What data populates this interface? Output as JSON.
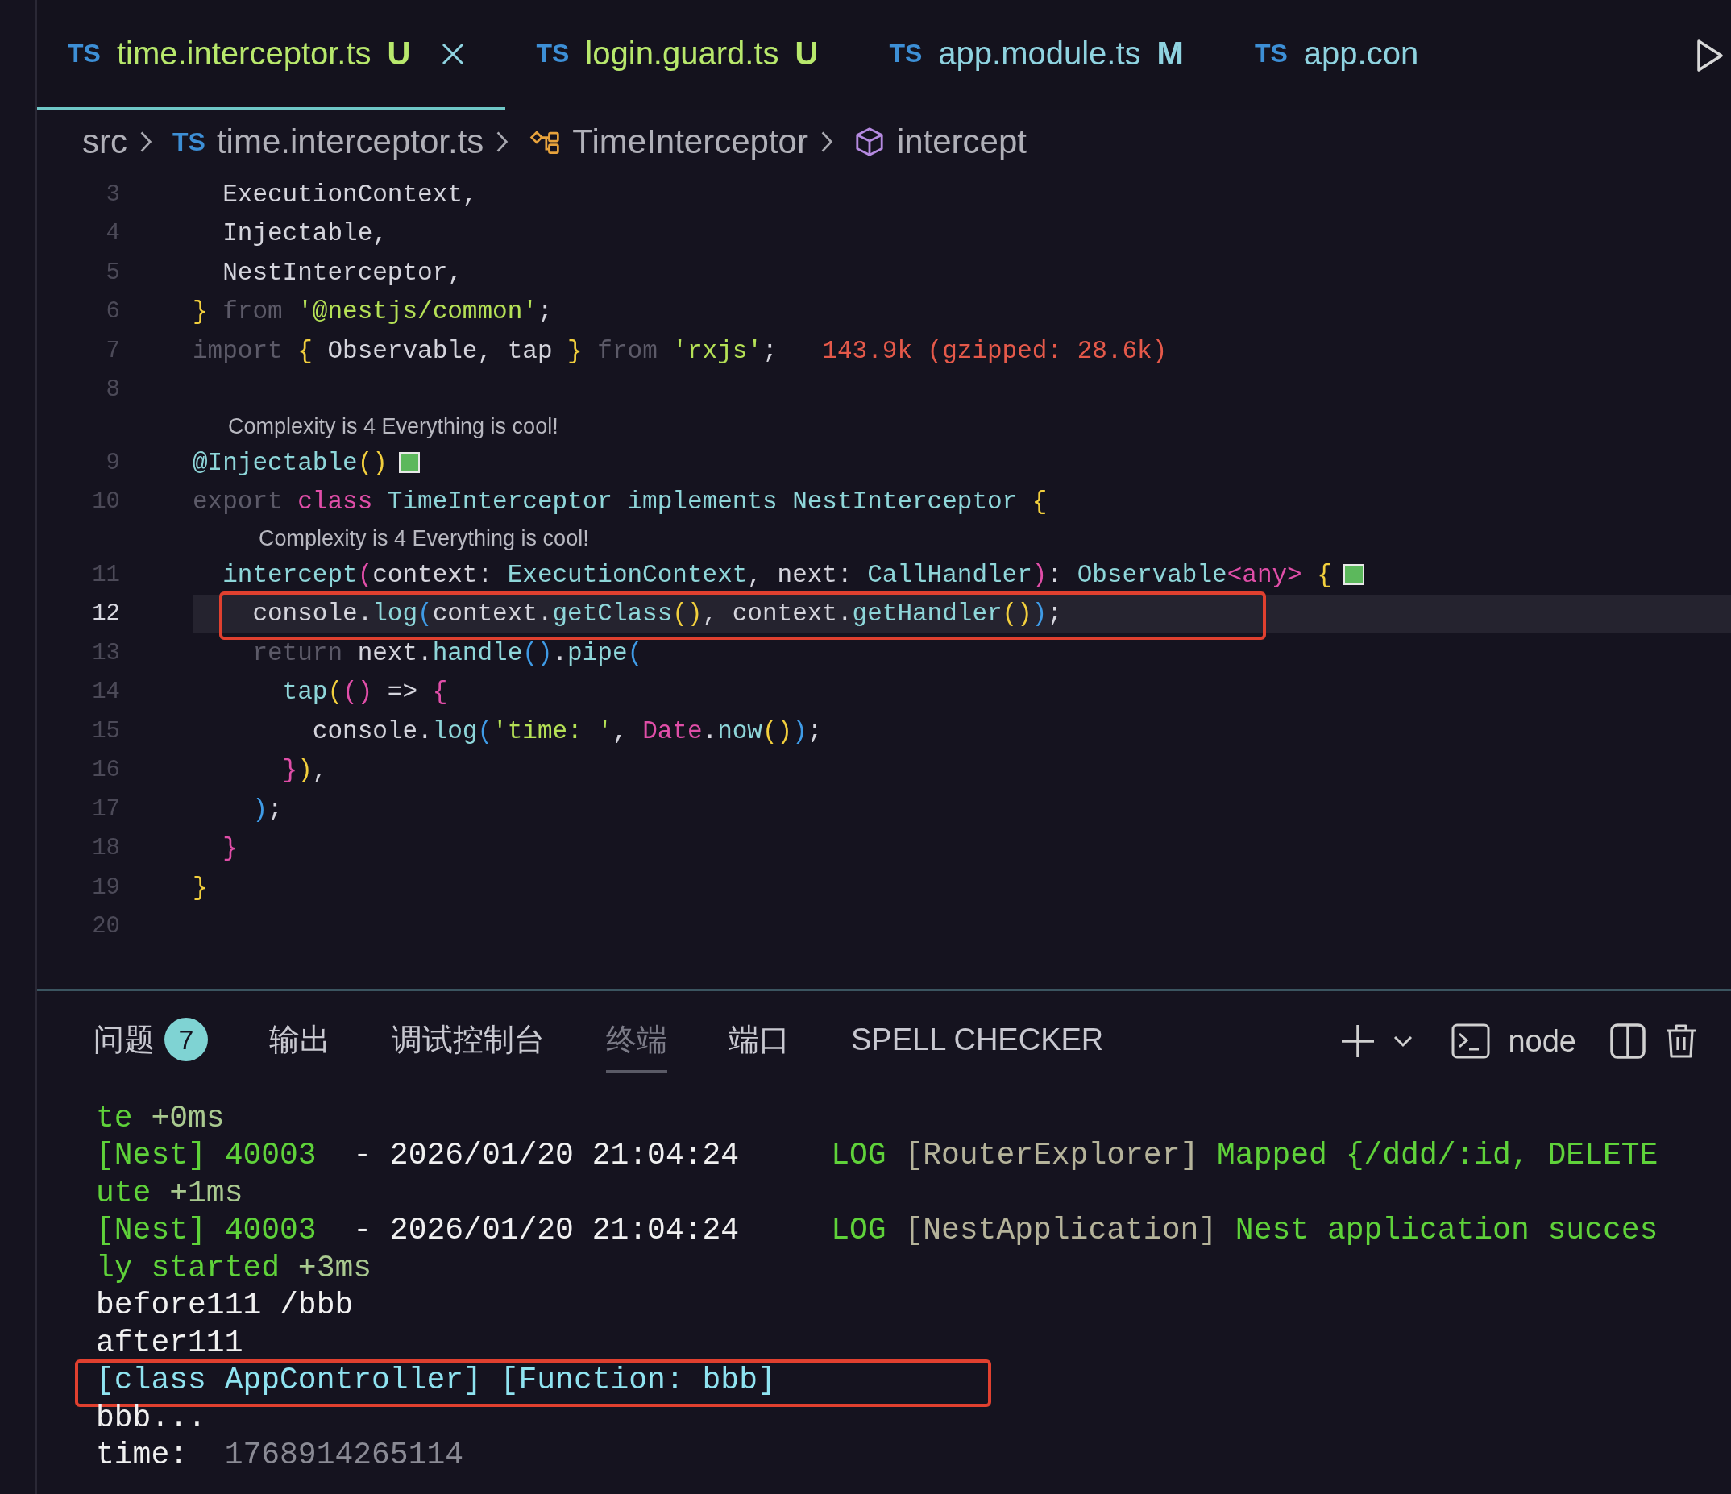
{
  "tabs": [
    {
      "icon_text": "TS",
      "label": "time.interceptor.ts",
      "status": "U",
      "color": "#b8e86c",
      "selected": true
    },
    {
      "icon_text": "TS",
      "label": "login.guard.ts",
      "status": "U",
      "color": "#b8e86c",
      "selected": false
    },
    {
      "icon_text": "TS",
      "label": "app.module.ts",
      "status": "M",
      "color": "#8fd3e0",
      "selected": false
    },
    {
      "icon_text": "TS",
      "label": "app.con",
      "color": "#8fd3e0",
      "selected": false
    }
  ],
  "breadcrumb": [
    {
      "kind": "folder",
      "label": "src"
    },
    {
      "kind": "file",
      "icon_text": "TS",
      "label": "time.interceptor.ts"
    },
    {
      "kind": "class",
      "label": "TimeInterceptor"
    },
    {
      "kind": "method",
      "label": "intercept"
    }
  ],
  "code_lines": [
    {
      "kind": "code",
      "number": "3",
      "tokens": [
        {
          "text": "  ExecutionContext,",
          "kind": "plain"
        }
      ]
    },
    {
      "kind": "code",
      "number": "4",
      "tokens": [
        {
          "text": "  Injectable,",
          "kind": "plain"
        }
      ]
    },
    {
      "kind": "code",
      "number": "5",
      "tokens": [
        {
          "text": "  NestInterceptor,",
          "kind": "plain"
        }
      ]
    },
    {
      "kind": "code",
      "number": "6",
      "tokens": [
        {
          "text": "}",
          "kind": "brace"
        },
        {
          "text": " from ",
          "kind": "keyword"
        },
        {
          "text": "'@nestjs/common'",
          "kind": "string"
        },
        {
          "text": ";",
          "kind": "plain"
        }
      ]
    },
    {
      "kind": "code",
      "number": "7",
      "tokens": [
        {
          "text": "import ",
          "kind": "keyword"
        },
        {
          "text": "{",
          "kind": "brace"
        },
        {
          "text": " Observable, tap ",
          "kind": "plain"
        },
        {
          "text": "}",
          "kind": "brace"
        },
        {
          "text": " from ",
          "kind": "keyword"
        },
        {
          "text": "'rxjs'",
          "kind": "string"
        },
        {
          "text": ";",
          "kind": "plain"
        },
        {
          "text": "   143.9k (gzipped: 28.6k)",
          "kind": "hint"
        }
      ]
    },
    {
      "kind": "code",
      "number": "8"
    },
    {
      "kind": "codelens",
      "text": "Complexity is 4 Everything is cool!"
    },
    {
      "kind": "code",
      "number": "9",
      "status_marker": true,
      "tokens": [
        {
          "text": "@Injectable",
          "kind": "fn"
        },
        {
          "text": "()",
          "kind": "brace"
        }
      ]
    },
    {
      "kind": "code",
      "number": "10",
      "tokens": [
        {
          "text": "export ",
          "kind": "keyword"
        },
        {
          "text": "class ",
          "kind": "accent"
        },
        {
          "text": "TimeInterceptor",
          "kind": "fn"
        },
        {
          "text": " implements ",
          "kind": "fn"
        },
        {
          "text": "NestInterceptor",
          "kind": "fn"
        },
        {
          "text": " {",
          "kind": "brace"
        }
      ]
    },
    {
      "kind": "codelens",
      "indented": true,
      "text": "Complexity is 4 Everything is cool!"
    },
    {
      "kind": "code",
      "number": "11",
      "status_marker": true,
      "tokens": [
        {
          "text": "  intercept",
          "kind": "fn"
        },
        {
          "text": "(",
          "kind": "accent"
        },
        {
          "text": "context: ",
          "kind": "plain"
        },
        {
          "text": "ExecutionContext",
          "kind": "fn"
        },
        {
          "text": ", next: ",
          "kind": "plain"
        },
        {
          "text": "CallHandler",
          "kind": "fn"
        },
        {
          "text": ")",
          "kind": "accent"
        },
        {
          "text": ": ",
          "kind": "plain"
        },
        {
          "text": "Observable",
          "kind": "fn"
        },
        {
          "text": "<any>",
          "kind": "accent"
        },
        {
          "text": " {",
          "kind": "brace"
        }
      ]
    },
    {
      "kind": "code",
      "number": "12",
      "current": true,
      "boxed": true,
      "tokens": [
        {
          "text": "    console.",
          "kind": "plain"
        },
        {
          "text": "log",
          "kind": "fn"
        },
        {
          "text": "(",
          "kind": "paren"
        },
        {
          "text": "context.",
          "kind": "plain"
        },
        {
          "text": "getClass",
          "kind": "fn"
        },
        {
          "text": "()",
          "kind": "brace"
        },
        {
          "text": ", context.",
          "kind": "plain"
        },
        {
          "text": "getHandler",
          "kind": "fn"
        },
        {
          "text": "()",
          "kind": "brace"
        },
        {
          "text": ")",
          "kind": "paren"
        },
        {
          "text": ";",
          "kind": "plain"
        }
      ]
    },
    {
      "kind": "code",
      "number": "13",
      "tokens": [
        {
          "text": "    return ",
          "kind": "keyword"
        },
        {
          "text": "next.",
          "kind": "plain"
        },
        {
          "text": "handle",
          "kind": "fn"
        },
        {
          "text": "()",
          "kind": "paren"
        },
        {
          "text": ".",
          "kind": "plain"
        },
        {
          "text": "pipe",
          "kind": "fn"
        },
        {
          "text": "(",
          "kind": "paren"
        }
      ]
    },
    {
      "kind": "code",
      "number": "14",
      "tokens": [
        {
          "text": "      tap",
          "kind": "fn"
        },
        {
          "text": "(",
          "kind": "brace"
        },
        {
          "text": "()",
          "kind": "accent"
        },
        {
          "text": " => ",
          "kind": "plain"
        },
        {
          "text": "{",
          "kind": "accent"
        }
      ]
    },
    {
      "kind": "code",
      "number": "15",
      "tokens": [
        {
          "text": "        console.",
          "kind": "plain"
        },
        {
          "text": "log",
          "kind": "fn"
        },
        {
          "text": "(",
          "kind": "paren"
        },
        {
          "text": "'time: '",
          "kind": "string"
        },
        {
          "text": ", ",
          "kind": "plain"
        },
        {
          "text": "Date",
          "kind": "accent"
        },
        {
          "text": ".",
          "kind": "plain"
        },
        {
          "text": "now",
          "kind": "fn"
        },
        {
          "text": "()",
          "kind": "brace"
        },
        {
          "text": ")",
          "kind": "paren"
        },
        {
          "text": ";",
          "kind": "plain"
        }
      ]
    },
    {
      "kind": "code",
      "number": "16",
      "tokens": [
        {
          "text": "      }",
          "kind": "accent"
        },
        {
          "text": ")",
          "kind": "brace"
        },
        {
          "text": ",",
          "kind": "plain"
        }
      ]
    },
    {
      "kind": "code",
      "number": "17",
      "tokens": [
        {
          "text": "    )",
          "kind": "paren"
        },
        {
          "text": ";",
          "kind": "plain"
        }
      ]
    },
    {
      "kind": "code",
      "number": "18",
      "tokens": [
        {
          "text": "  }",
          "kind": "accent"
        }
      ]
    },
    {
      "kind": "code",
      "number": "19",
      "tokens": [
        {
          "text": "}",
          "kind": "brace"
        }
      ]
    },
    {
      "kind": "code",
      "number": "20"
    }
  ],
  "panel": {
    "tabs": [
      {
        "label": "问题",
        "badge": "7",
        "selected": false
      },
      {
        "label": "输出",
        "selected": false
      },
      {
        "label": "调试控制台",
        "selected": false
      },
      {
        "label": "终端",
        "selected": true
      },
      {
        "label": "端口",
        "selected": false
      },
      {
        "label": "SPELL CHECKER",
        "selected": false
      }
    ],
    "terminal_name": "node"
  },
  "terminal_lines": [
    {
      "segments": [
        {
          "text": "te",
          "kind": "green"
        },
        {
          "text": " +0ms",
          "kind": "timing"
        }
      ]
    },
    {
      "segments": [
        {
          "text": "[Nest] 40003",
          "kind": "green"
        },
        {
          "text": "  - 2026/01/20 21:04:24",
          "kind": "white"
        },
        {
          "text": "     LOG ",
          "kind": "green"
        },
        {
          "text": "[RouterExplorer] ",
          "kind": "label"
        },
        {
          "text": "Mapped {/ddd/:id, DELETE",
          "kind": "green"
        }
      ]
    },
    {
      "segments": [
        {
          "text": "ute",
          "kind": "green"
        },
        {
          "text": " +1ms",
          "kind": "timing"
        }
      ]
    },
    {
      "segments": [
        {
          "text": "[Nest] 40003",
          "kind": "green"
        },
        {
          "text": "  - 2026/01/20 21:04:24",
          "kind": "white"
        },
        {
          "text": "     LOG ",
          "kind": "green"
        },
        {
          "text": "[NestApplication] ",
          "kind": "label"
        },
        {
          "text": "Nest application succes",
          "kind": "green"
        }
      ]
    },
    {
      "segments": [
        {
          "text": "ly started",
          "kind": "green"
        },
        {
          "text": " +3ms",
          "kind": "timing"
        }
      ]
    },
    {
      "segments": [
        {
          "text": "before111 /bbb",
          "kind": "white"
        }
      ]
    },
    {
      "segments": [
        {
          "text": "after111",
          "kind": "white"
        }
      ]
    },
    {
      "boxed": true,
      "segments": [
        {
          "text": "[class AppController] [Function: bbb]",
          "kind": "cyan"
        }
      ]
    },
    {
      "segments": [
        {
          "text": "bbb...",
          "kind": "white"
        }
      ]
    },
    {
      "segments": [
        {
          "text": "time:",
          "kind": "white"
        },
        {
          "text": "  1768914265114",
          "kind": "dim"
        }
      ]
    }
  ]
}
